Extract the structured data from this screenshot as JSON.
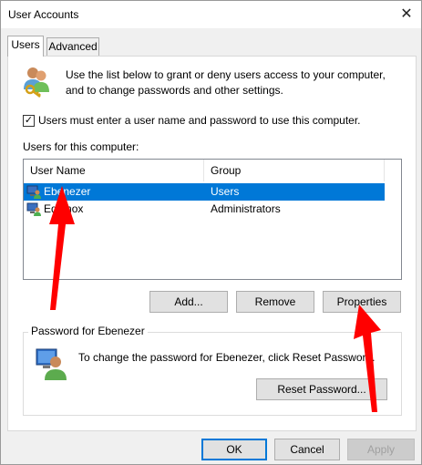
{
  "window": {
    "title": "User Accounts",
    "close_symbol": "✕"
  },
  "tabs": [
    {
      "label": "Users",
      "active": true
    },
    {
      "label": "Advanced",
      "active": false
    }
  ],
  "description": "Use the list below to grant or deny users access to your computer, and to change passwords and other settings.",
  "require_login": {
    "checked": true,
    "check_symbol": "✓",
    "label": "Users must enter a user name and password to use this computer."
  },
  "users_list": {
    "label": "Users for this computer:",
    "columns": [
      "User Name",
      "Group"
    ],
    "rows": [
      {
        "user": "Ebenezer",
        "group": "Users",
        "selected": true
      },
      {
        "user": "Equinox",
        "group": "Administrators",
        "selected": false
      }
    ]
  },
  "list_buttons": {
    "add": "Add...",
    "remove": "Remove",
    "properties": "Properties"
  },
  "password_group": {
    "title": "Password for Ebenezer",
    "text": "To change the password for Ebenezer, click Reset Password.",
    "reset_button": "Reset Password..."
  },
  "footer_buttons": {
    "ok": "OK",
    "cancel": "Cancel",
    "apply": "Apply"
  },
  "colors": {
    "selection": "#0078d7",
    "annotation_arrow": "#ff0000"
  },
  "icons": {
    "header": "users-keys-icon",
    "row": "user-monitor-icon",
    "password": "user-password-icon"
  }
}
